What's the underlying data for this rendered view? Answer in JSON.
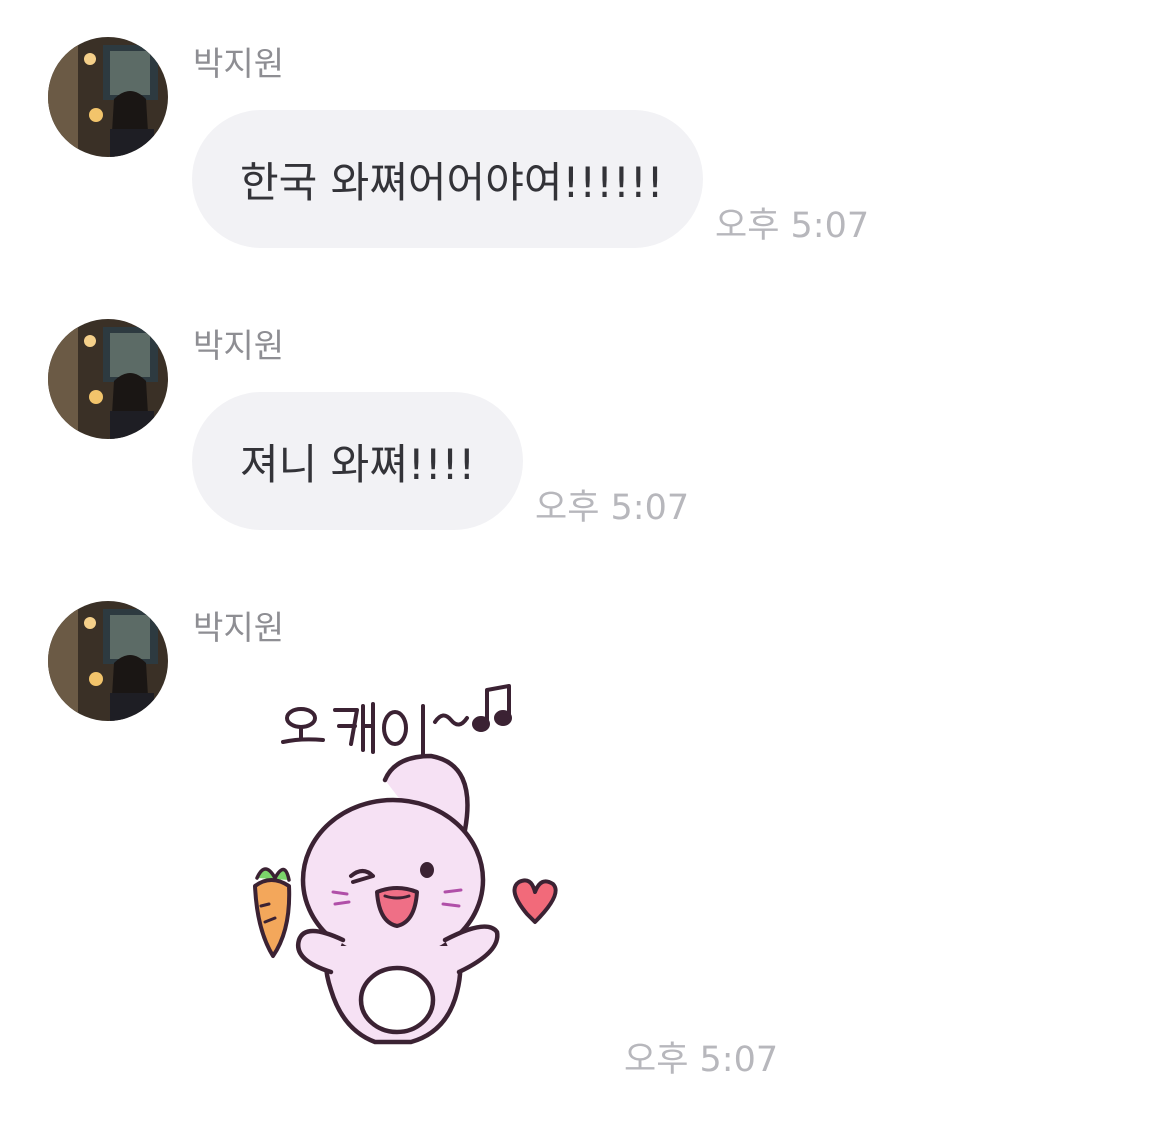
{
  "messages": [
    {
      "sender": "박지원",
      "type": "text",
      "text": "한국 와쪄어어야여!!!!!!",
      "time": "오후 5:07"
    },
    {
      "sender": "박지원",
      "type": "text",
      "text": "져니 와쪄!!!!",
      "time": "오후 5:07"
    },
    {
      "sender": "박지원",
      "type": "sticker",
      "sticker": {
        "caption": "오케이~♫",
        "character": "pink-bunny-with-carrot-and-heart"
      },
      "time": "오후 5:07"
    }
  ],
  "colors": {
    "bubble": "#f2f2f5",
    "sender": "#8e8e93",
    "time": "#b7b7bc",
    "text": "#333338"
  }
}
